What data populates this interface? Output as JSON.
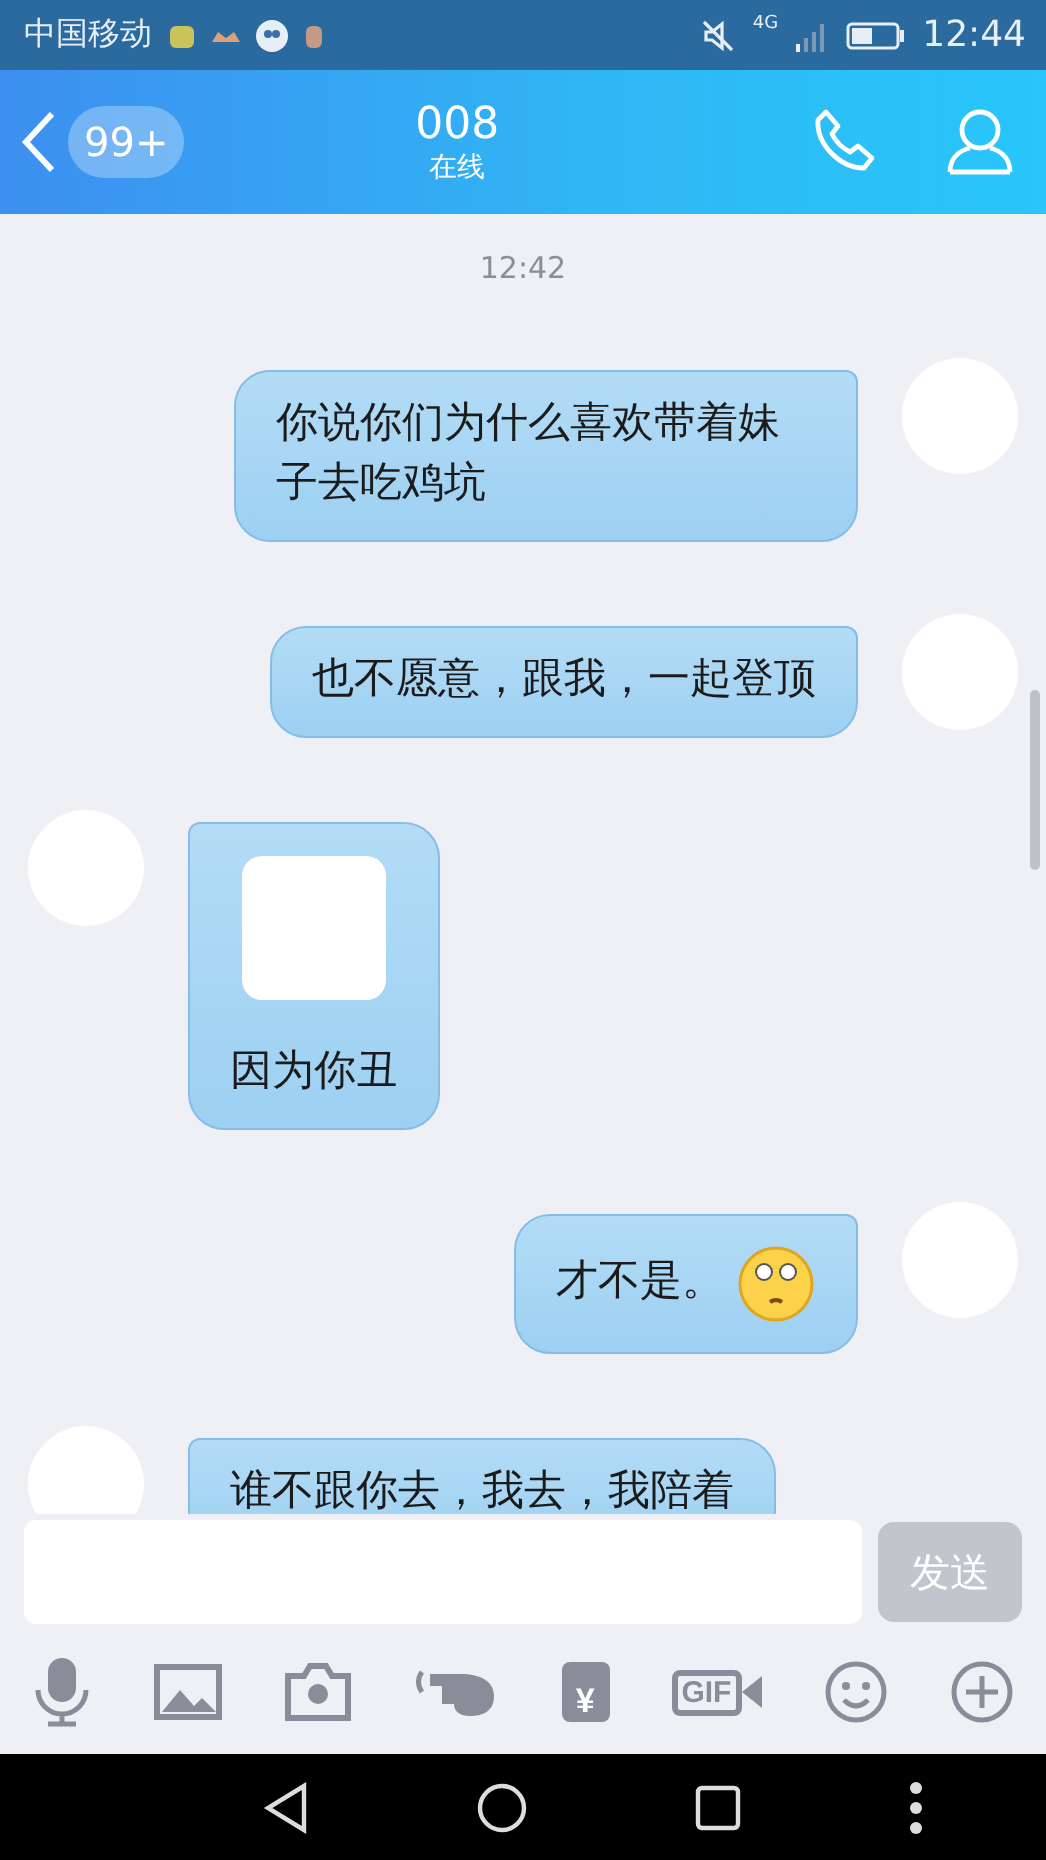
{
  "status_bar": {
    "carrier": "中国移动",
    "network": "4G",
    "time": "12:44"
  },
  "header": {
    "badge": "99+",
    "title": "008",
    "subtitle": "在线"
  },
  "chat": {
    "timestamp": "12:42",
    "messages": [
      {
        "outgoing": true,
        "kind": "text",
        "text": "你说你们为什么喜欢带着妹子去吃鸡坑"
      },
      {
        "outgoing": true,
        "kind": "text",
        "text": "也不愿意，跟我，一起登顶"
      },
      {
        "outgoing": false,
        "kind": "sticker",
        "text": "因为你丑"
      },
      {
        "outgoing": true,
        "kind": "emoji",
        "text": "才不是。"
      },
      {
        "outgoing": false,
        "kind": "text",
        "text": "谁不跟你去，我去，我陪着"
      }
    ]
  },
  "composer": {
    "send": "发送",
    "send_disabled": true
  },
  "toolbar": [
    {
      "kind": "mic"
    },
    {
      "kind": "image"
    },
    {
      "kind": "camera"
    },
    {
      "kind": "poke"
    },
    {
      "kind": "redpacket",
      "glyph": "¥"
    },
    {
      "kind": "gif",
      "label": "GIF"
    },
    {
      "kind": "emoji"
    },
    {
      "kind": "plus"
    }
  ]
}
